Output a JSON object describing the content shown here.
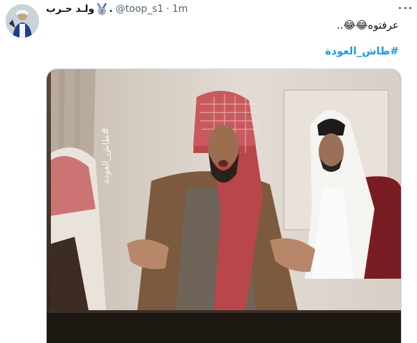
{
  "tweet": {
    "author": {
      "display_name": "ولـد حـرب",
      "badge_icon": "medal-2-icon",
      "dot": ".",
      "handle": "@toop_s1",
      "separator": "·",
      "timestamp": "1m"
    },
    "text": "عرفتوه😂😂..",
    "hashtag": "#طاش_العودة",
    "media": {
      "watermark": "#طاش_العودة"
    },
    "more_icon": "more-horizontal-icon"
  },
  "colors": {
    "link": "#1d9bf0",
    "secondary_text": "#536471",
    "border": "#cfd9de"
  }
}
